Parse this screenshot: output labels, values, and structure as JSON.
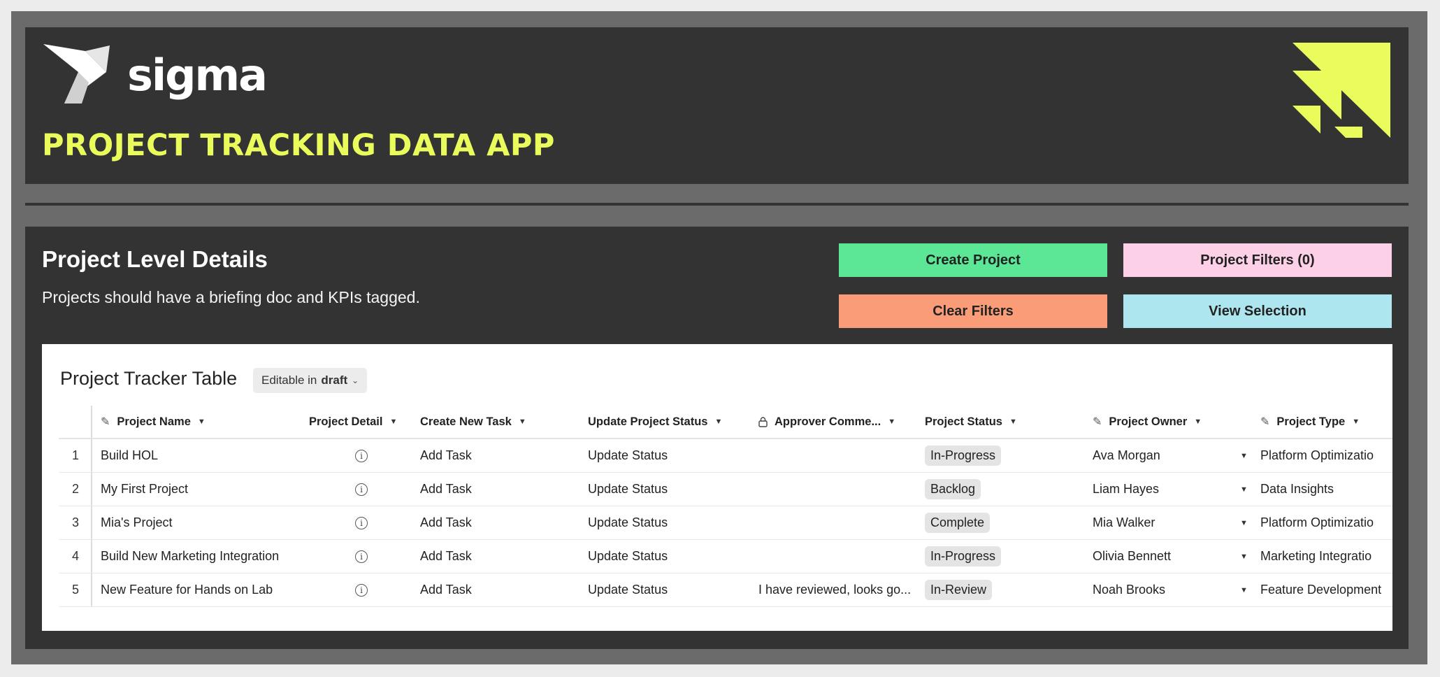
{
  "header": {
    "logo_text": "sigma",
    "title": "PROJECT TRACKING DATA APP",
    "accent_color": "#eafc5b"
  },
  "section": {
    "title": "Project Level Details",
    "subtitle": "Projects should have a briefing doc and KPIs tagged."
  },
  "buttons": {
    "create": "Create Project",
    "filters": "Project Filters (0)",
    "clear": "Clear Filters",
    "view": "View Selection"
  },
  "table": {
    "title": "Project Tracker Table",
    "badge_prefix": "Editable in",
    "badge_mode": "draft",
    "columns": [
      "Project Name",
      "Project Detail",
      "Create New Task",
      "Update Project Status",
      "Approver Comme...",
      "Project Status",
      "Project Owner",
      "Project Type"
    ],
    "rows": [
      {
        "num": "1",
        "name": "Build HOL",
        "task": "Add Task",
        "update": "Update Status",
        "comment": "",
        "status": "In-Progress",
        "owner": "Ava Morgan",
        "type": "Platform Optimizatio"
      },
      {
        "num": "2",
        "name": "My First Project",
        "task": "Add Task",
        "update": "Update Status",
        "comment": "",
        "status": "Backlog",
        "owner": "Liam Hayes",
        "type": "Data Insights"
      },
      {
        "num": "3",
        "name": "Mia's Project",
        "task": "Add Task",
        "update": "Update Status",
        "comment": "",
        "status": "Complete",
        "owner": "Mia Walker",
        "type": "Platform Optimizatio"
      },
      {
        "num": "4",
        "name": "Build New Marketing Integration",
        "task": "Add Task",
        "update": "Update Status",
        "comment": "",
        "status": "In-Progress",
        "owner": "Olivia Bennett",
        "type": "Marketing Integratio"
      },
      {
        "num": "5",
        "name": "New Feature for Hands on Lab",
        "task": "Add Task",
        "update": "Update Status",
        "comment": "I have reviewed, looks go...",
        "status": "In-Review",
        "owner": "Noah Brooks",
        "type": "Feature Development"
      }
    ]
  }
}
